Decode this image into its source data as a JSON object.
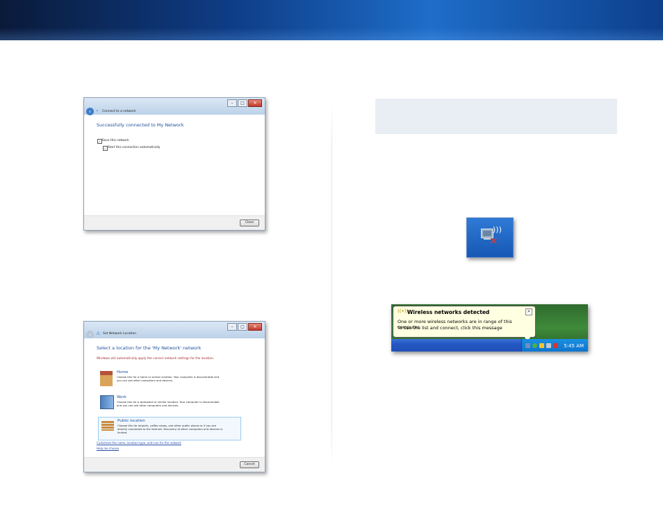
{
  "dialog1": {
    "title": "Connect to a network",
    "heading": "Successfully connected to My Network",
    "save_label": "Save this network",
    "auto_label": "Start this connection automatically",
    "close_button": "Close"
  },
  "dialog2": {
    "title": "Set Network Location",
    "heading": "Select a location for the 'My Network' network",
    "intro": "Windows will automatically apply the correct network settings for the location.",
    "options": [
      {
        "title": "Home",
        "desc1": "Choose this for a home or similar location. Your computer is discoverable and",
        "desc2": "you can see other computers and devices."
      },
      {
        "title": "Work",
        "desc1": "Choose this for a workplace or similar location. Your computer is discoverable",
        "desc2": "and you can see other computers and devices."
      },
      {
        "title": "Public location",
        "desc1": "Choose this for airports, coffee shops, and other public places or if you are",
        "desc2": "directly connected to the Internet. Discovery of other computers and devices is",
        "desc3": "limited."
      }
    ],
    "customize_link": "Customize the name, location type, and icon for the network",
    "help_link": "Help me choose",
    "cancel_button": "Cancel"
  },
  "balloon": {
    "title": "Wireless networks detected",
    "line1": "One or more wireless networks are in range of this computer.",
    "line2": "To see the list and connect, click this message",
    "time": "5:45 AM"
  }
}
